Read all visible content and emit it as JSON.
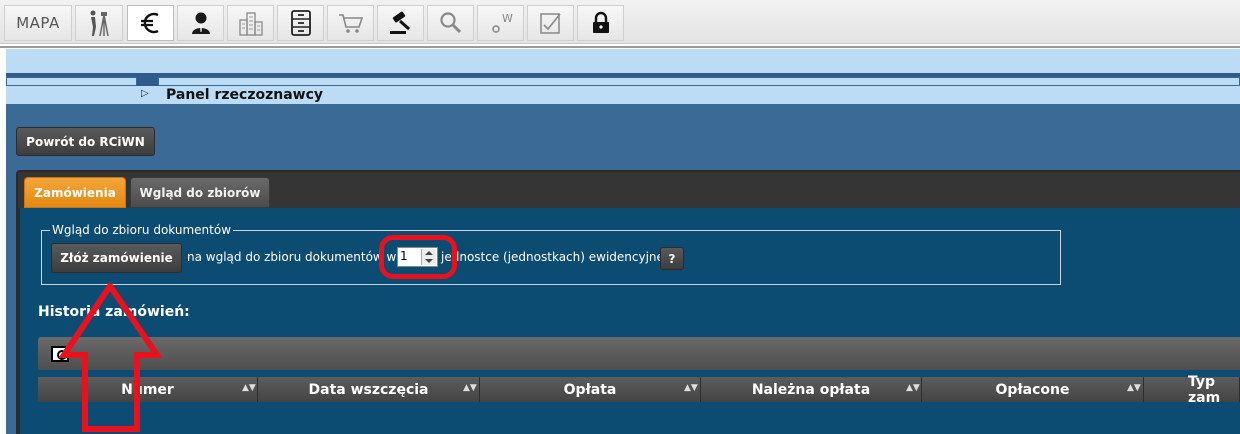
{
  "toolbar": {
    "buttons": [
      {
        "label": "MAPA",
        "icon": ""
      },
      {
        "label": "",
        "icon": "surveyor-icon"
      },
      {
        "label": "",
        "icon": "euro-icon"
      },
      {
        "label": "",
        "icon": "user-icon"
      },
      {
        "label": "",
        "icon": "buildings-icon"
      },
      {
        "label": "",
        "icon": "cabinet-icon"
      },
      {
        "label": "",
        "icon": "cart-icon"
      },
      {
        "label": "",
        "icon": "gavel-icon"
      },
      {
        "label": "",
        "icon": "search-icon"
      },
      {
        "label": "",
        "icon": "w-settings-icon"
      },
      {
        "label": "",
        "icon": "signed-doc-icon"
      },
      {
        "label": "",
        "icon": "lock-icon"
      }
    ],
    "active_index": 2
  },
  "panel": {
    "arrow": "▷",
    "title": "Panel rzeczoznawcy"
  },
  "back_button": "Powrót do RCiWN",
  "tabs": [
    {
      "label": "Zamówienia",
      "active": true
    },
    {
      "label": "Wgląd do zbiorów",
      "active": false
    }
  ],
  "order_section": {
    "legend": "Wgląd do zbioru dokumentów",
    "submit_button": "Złóż zamówienie",
    "text_before": "na wgląd do zbioru dokumentów w",
    "quantity_value": "1",
    "text_after": "jednostce (jednostkach) ewidencyjnej",
    "help_button": "?"
  },
  "history": {
    "title": "Historia zamówień:",
    "columns": [
      "Numer",
      "Data wszczęcia",
      "Opłata",
      "Należna opłata",
      "Opłacone",
      "Typ zam"
    ]
  },
  "colors": {
    "active_tab": "#f29a26",
    "content_bg": "#0c4c73",
    "annotation": "#e8111d"
  }
}
